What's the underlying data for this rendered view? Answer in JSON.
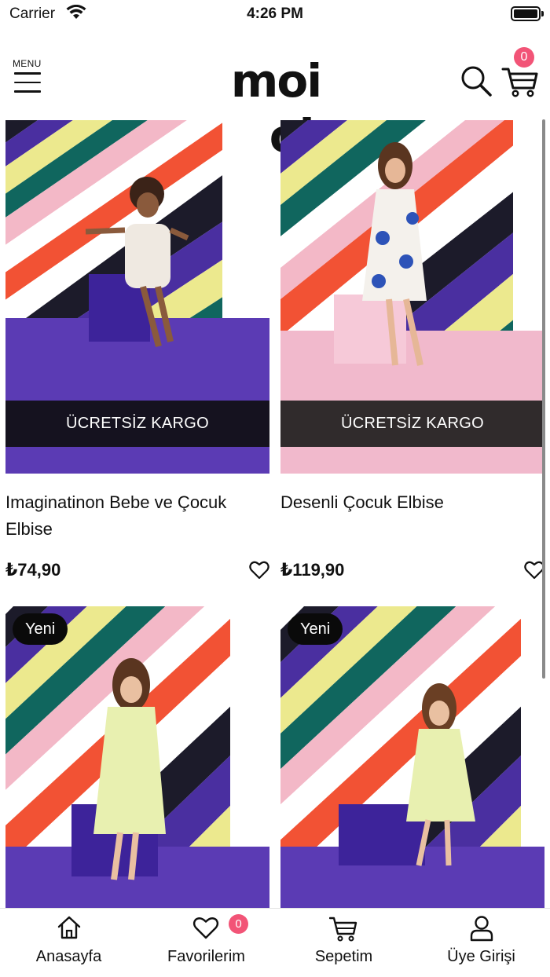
{
  "status_bar": {
    "carrier": "Carrier",
    "time": "4:26 PM"
  },
  "header": {
    "menu_label": "MENU",
    "logo": "moi noi",
    "cart_count": "0"
  },
  "products": [
    {
      "name": "Imaginatinon Bebe ve Çocuk Elbise",
      "price": "₺74,90",
      "promo": "ÜCRETSİZ KARGO",
      "badge": ""
    },
    {
      "name": "Desenli Çocuk Elbise",
      "price": "₺119,90",
      "promo": "ÜCRETSİZ KARGO",
      "badge": ""
    },
    {
      "name": "",
      "price": "",
      "promo": "",
      "badge": "Yeni"
    },
    {
      "name": "",
      "price": "",
      "promo": "",
      "badge": "Yeni"
    }
  ],
  "tabbar": {
    "tabs": [
      {
        "label": "Anasayfa",
        "icon": "home-icon"
      },
      {
        "label": "Favorilerim",
        "icon": "heart-icon",
        "badge": "0"
      },
      {
        "label": "Sepetim",
        "icon": "cart-icon"
      },
      {
        "label": "Üye Girişi",
        "icon": "user-icon"
      }
    ]
  },
  "colors": {
    "accent_badge": "#f25477",
    "stripe_colors": [
      "#1c1b2a",
      "#4a2fa0",
      "#ece98e",
      "#10665e",
      "#f3b8c7",
      "#f25234",
      "#ffffff"
    ],
    "floor": "#5b3bb4"
  }
}
